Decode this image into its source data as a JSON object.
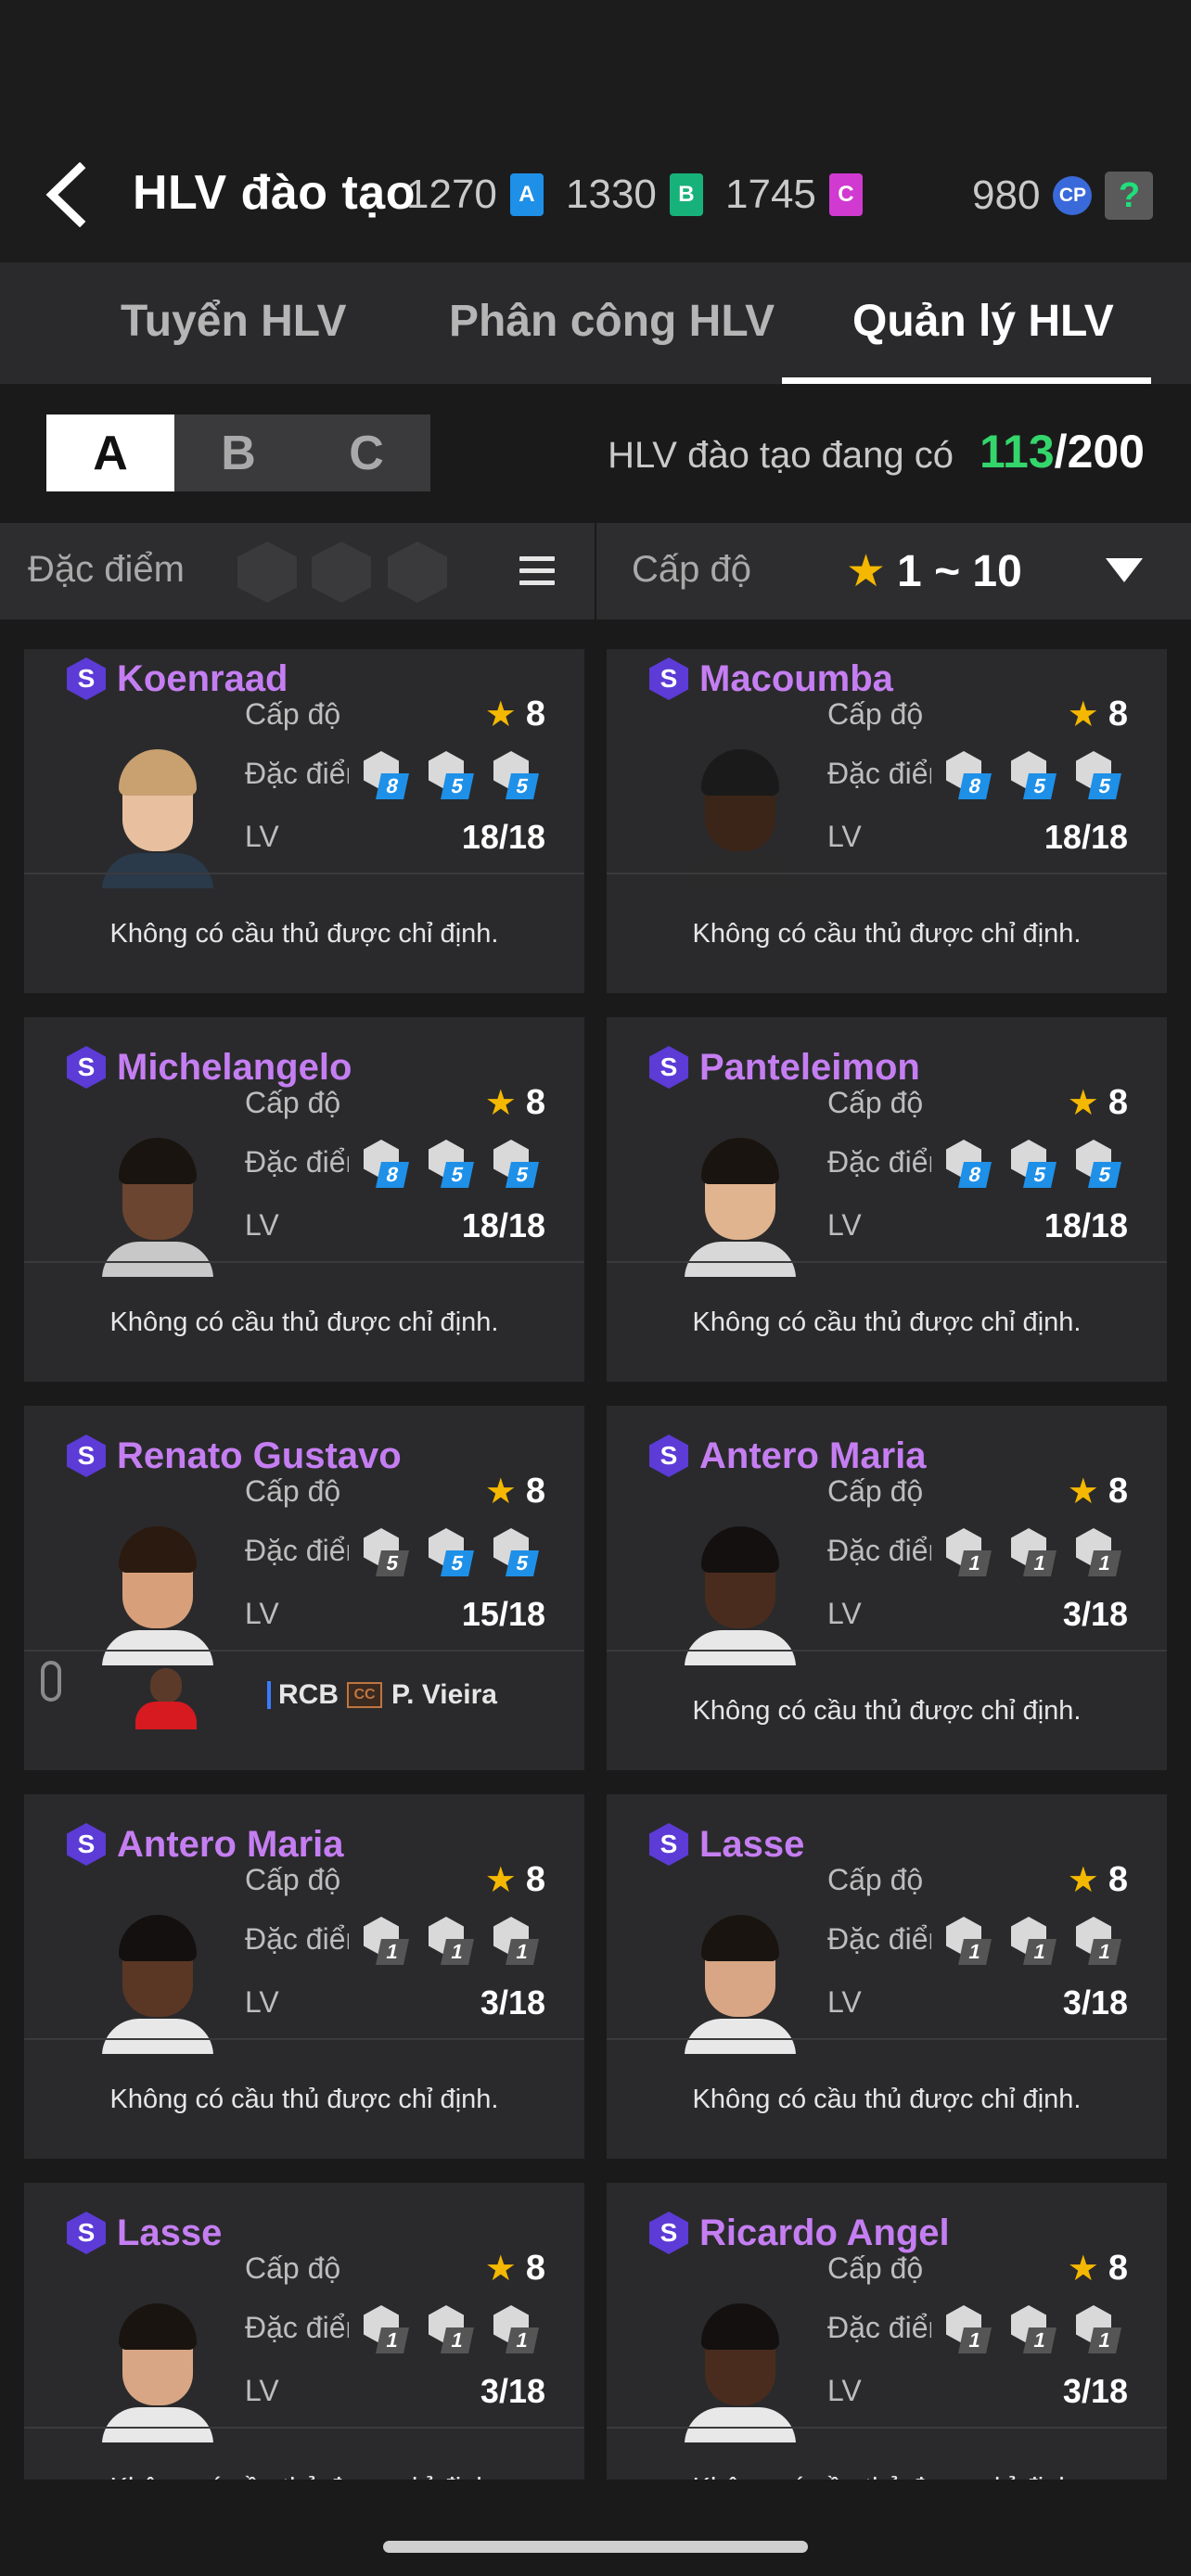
{
  "header": {
    "title": "HLV đào tạo",
    "currencies": [
      {
        "value": "1270",
        "badge": "A",
        "color": "#1e90e8"
      },
      {
        "value": "1330",
        "badge": "B",
        "color": "#17b27a"
      },
      {
        "value": "1745",
        "badge": "C",
        "color": "#d03ad0"
      }
    ],
    "cp_value": "980",
    "cp_badge": "CP",
    "help_label": "?"
  },
  "tabs": [
    {
      "label": "Tuyển HLV",
      "active": false
    },
    {
      "label": "Phân công HLV",
      "active": false
    },
    {
      "label": "Quản lý HLV",
      "active": true
    }
  ],
  "segments": [
    {
      "label": "A",
      "active": true
    },
    {
      "label": "B",
      "active": false
    },
    {
      "label": "C",
      "active": false
    }
  ],
  "count": {
    "label": "HLV đào tạo đang có",
    "current": "113",
    "max": "/200"
  },
  "filter": {
    "trait_label": "Đặc điểm c",
    "level_label": "Cấp độ",
    "level_star": "★",
    "level_range": "1 ~ 10"
  },
  "labels": {
    "level": "Cấp độ",
    "traits": "Đặc điểm",
    "lv": "LV",
    "star": "★",
    "s_badge": "S"
  },
  "coaches": [
    {
      "name": "Koenraad",
      "level": "8",
      "lv": "18/18",
      "traits": [
        {
          "v": "8",
          "c": "#1e90e8"
        },
        {
          "v": "5",
          "c": "#1e90e8"
        },
        {
          "v": "5",
          "c": "#1e90e8"
        }
      ],
      "footer": "Không có cầu thủ được chỉ định.",
      "skin": "#e8c0a0",
      "hair": "#c9a070",
      "shirt": "#2a3a4a"
    },
    {
      "name": "Macoumba",
      "level": "8",
      "lv": "18/18",
      "traits": [
        {
          "v": "8",
          "c": "#1e90e8"
        },
        {
          "v": "5",
          "c": "#1e90e8"
        },
        {
          "v": "5",
          "c": "#1e90e8"
        }
      ],
      "footer": "Không có cầu thủ được chỉ định.",
      "skin": "#3b2418",
      "hair": "#1a1a1a",
      "shirt": "#2a2a2a"
    },
    {
      "name": "Michelangelo",
      "level": "8",
      "lv": "18/18",
      "traits": [
        {
          "v": "8",
          "c": "#1e90e8"
        },
        {
          "v": "5",
          "c": "#1e90e8"
        },
        {
          "v": "5",
          "c": "#1e90e8"
        }
      ],
      "footer": "Không có cầu thủ được chỉ định.",
      "skin": "#6b4530",
      "hair": "#1a1410",
      "shirt": "#c8c8c8"
    },
    {
      "name": "Panteleimon",
      "level": "8",
      "lv": "18/18",
      "traits": [
        {
          "v": "8",
          "c": "#1e90e8"
        },
        {
          "v": "5",
          "c": "#1e90e8"
        },
        {
          "v": "5",
          "c": "#1e90e8"
        }
      ],
      "footer": "Không có cầu thủ được chỉ định.",
      "skin": "#e0b48e",
      "hair": "#1a1410",
      "shirt": "#d8d8d8"
    },
    {
      "name": "Renato Gustavo",
      "level": "8",
      "lv": "15/18",
      "traits": [
        {
          "v": "5",
          "c": "#555555"
        },
        {
          "v": "5",
          "c": "#1e90e8"
        },
        {
          "v": "5",
          "c": "#1e90e8"
        }
      ],
      "footer": "",
      "assigned": {
        "position": "RCB",
        "player": "P. Vieira"
      },
      "skin": "#d8a07a",
      "hair": "#2a1a10",
      "shirt": "#e8e8e8"
    },
    {
      "name": "Antero Maria",
      "level": "8",
      "lv": "3/18",
      "traits": [
        {
          "v": "1",
          "c": "#555555"
        },
        {
          "v": "1",
          "c": "#555555"
        },
        {
          "v": "1",
          "c": "#555555"
        }
      ],
      "footer": "Không có cầu thủ được chỉ định.",
      "skin": "#4a2c1e",
      "hair": "#141010",
      "shirt": "#e8e8e8"
    },
    {
      "name": "Antero Maria",
      "level": "8",
      "lv": "3/18",
      "traits": [
        {
          "v": "1",
          "c": "#555555"
        },
        {
          "v": "1",
          "c": "#555555"
        },
        {
          "v": "1",
          "c": "#555555"
        }
      ],
      "footer": "Không có cầu thủ được chỉ định.",
      "skin": "#5a3624",
      "hair": "#141010",
      "shirt": "#e8e8e8"
    },
    {
      "name": "Lasse",
      "level": "8",
      "lv": "3/18",
      "traits": [
        {
          "v": "1",
          "c": "#555555"
        },
        {
          "v": "1",
          "c": "#555555"
        },
        {
          "v": "1",
          "c": "#555555"
        }
      ],
      "footer": "Không có cầu thủ được chỉ định.",
      "skin": "#d8a684",
      "hair": "#1a1410",
      "shirt": "#e8e8e8"
    },
    {
      "name": "Lasse",
      "level": "8",
      "lv": "3/18",
      "traits": [
        {
          "v": "1",
          "c": "#555555"
        },
        {
          "v": "1",
          "c": "#555555"
        },
        {
          "v": "1",
          "c": "#555555"
        }
      ],
      "footer": "Không có cầu thủ được chỉ định.",
      "skin": "#d8a684",
      "hair": "#1a1410",
      "shirt": "#e8e8e8"
    },
    {
      "name": "Ricardo Angel",
      "level": "8",
      "lv": "3/18",
      "traits": [
        {
          "v": "1",
          "c": "#555555"
        },
        {
          "v": "1",
          "c": "#555555"
        },
        {
          "v": "1",
          "c": "#555555"
        }
      ],
      "footer": "Không có cầu thủ được chỉ định.",
      "skin": "#4a2c1e",
      "hair": "#141010",
      "shirt": "#e8e8e8"
    }
  ]
}
